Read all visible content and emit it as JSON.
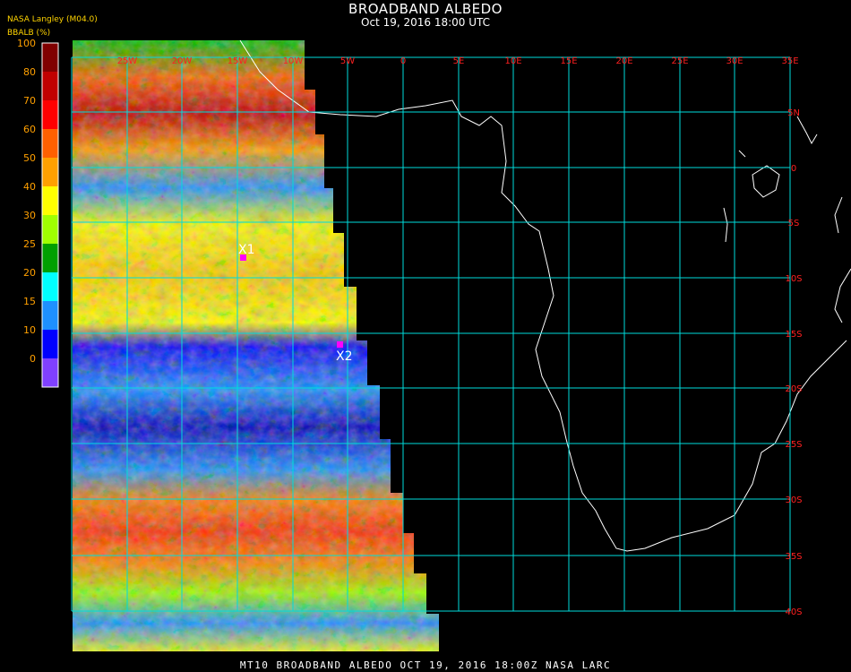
{
  "header": {
    "title": "BROADBAND ALBEDO",
    "subtitle": "Oct 19, 2016 18:00 UTC",
    "source": "NASA Langley (M04.0)",
    "unit": "BBALB (%)"
  },
  "colorbar": {
    "ticks": [
      "100",
      "80",
      "70",
      "60",
      "50",
      "40",
      "30",
      "25",
      "20",
      "15",
      "10",
      "0"
    ],
    "colors": [
      "#800000",
      "#c00000",
      "#ff0000",
      "#ff6000",
      "#ffa000",
      "#ffff00",
      "#a0ff00",
      "#00a000",
      "#00ffff",
      "#1e90ff",
      "#0000ff",
      "#8040ff"
    ]
  },
  "grid": {
    "color": "#00dcdc",
    "lon_labels": [
      "25W",
      "20W",
      "15W",
      "10W",
      "5W",
      "0",
      "5E",
      "10E",
      "15E",
      "20E",
      "25E",
      "30E",
      "35E"
    ],
    "lat_labels": [
      "5N",
      "0",
      "5S",
      "10S",
      "15S",
      "20S",
      "25S",
      "30S",
      "35S",
      "40S"
    ],
    "label_color": "#ff2020"
  },
  "markers": [
    {
      "label": "X1",
      "color": "#ff00ff"
    },
    {
      "label": "X2",
      "color": "#ff00ff"
    }
  ],
  "footer": "MT10  BROADBAND ALBEDO  OCT 19, 2016 18:00Z  NASA LARC"
}
